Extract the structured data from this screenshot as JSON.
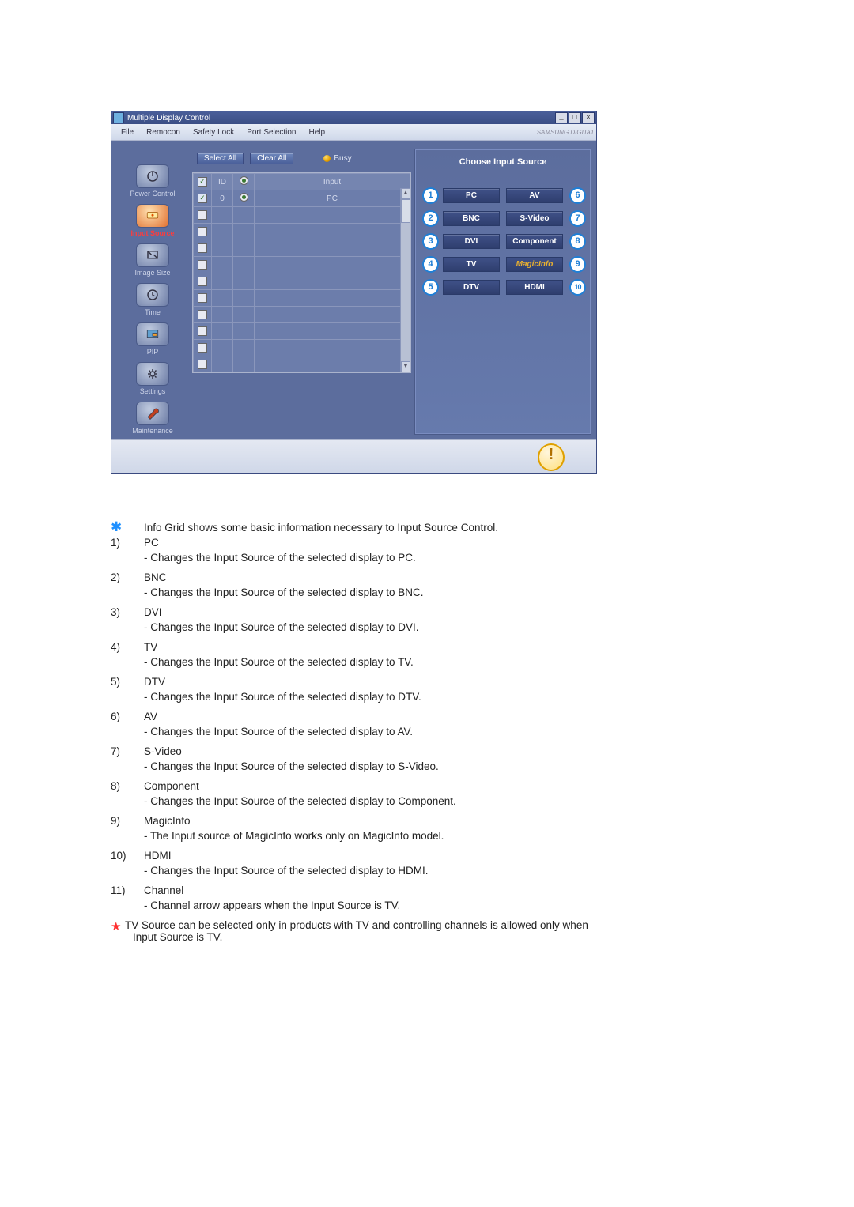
{
  "window": {
    "title": "Multiple Display Control",
    "menu": [
      "File",
      "Remocon",
      "Safety Lock",
      "Port Selection",
      "Help"
    ],
    "brand": "SAMSUNG DIGITall"
  },
  "sidebar": {
    "items": [
      {
        "label": "Power Control"
      },
      {
        "label": "Input Source"
      },
      {
        "label": "Image Size"
      },
      {
        "label": "Time"
      },
      {
        "label": "PIP"
      },
      {
        "label": "Settings"
      },
      {
        "label": "Maintenance"
      }
    ]
  },
  "toolbar": {
    "select_all": "Select All",
    "clear_all": "Clear All",
    "busy_label": "Busy"
  },
  "grid": {
    "headers": {
      "check": "✓",
      "id": "ID",
      "status": "",
      "input": "Input"
    },
    "row0": {
      "id": "0",
      "input": "PC"
    }
  },
  "right_panel": {
    "title": "Choose Input Source",
    "sources": {
      "s1": "PC",
      "s2": "BNC",
      "s3": "DVI",
      "s4": "TV",
      "s5": "DTV",
      "s6": "AV",
      "s7": "S-Video",
      "s8": "Component",
      "s9": "MagicInfo",
      "s10": "HDMI"
    },
    "numbers": {
      "n1": "1",
      "n2": "2",
      "n3": "3",
      "n4": "4",
      "n5": "5",
      "n6": "6",
      "n7": "7",
      "n8": "8",
      "n9": "9",
      "n10": "10"
    }
  },
  "explain": {
    "intro": "Info Grid shows some basic information necessary to Input Source Control.",
    "items": [
      {
        "n": "1)",
        "t": "PC",
        "d": "- Changes the Input Source of the selected display to PC."
      },
      {
        "n": "2)",
        "t": "BNC",
        "d": "- Changes the Input Source of the selected display to BNC."
      },
      {
        "n": "3)",
        "t": "DVI",
        "d": "- Changes the Input Source of the selected display to DVI."
      },
      {
        "n": "4)",
        "t": "TV",
        "d": "- Changes the Input Source of the selected display to TV."
      },
      {
        "n": "5)",
        "t": "DTV",
        "d": "- Changes the Input Source of the selected display to DTV."
      },
      {
        "n": "6)",
        "t": "AV",
        "d": "- Changes the Input Source of the selected display to AV."
      },
      {
        "n": "7)",
        "t": "S-Video",
        "d": "- Changes the Input Source of the selected display to S-Video."
      },
      {
        "n": "8)",
        "t": "Component",
        "d": "- Changes the Input Source of the selected display to Component."
      },
      {
        "n": "9)",
        "t": "MagicInfo",
        "d": "- The Input source of MagicInfo works only on MagicInfo model."
      },
      {
        "n": "10)",
        "t": "HDMI",
        "d": "- Changes the Input Source of the selected display to HDMI."
      },
      {
        "n": "11)",
        "t": "Channel",
        "d": "- Channel arrow appears when the Input Source is TV."
      }
    ],
    "footnote_a": "TV Source can be selected only in products with TV and controlling channels is allowed only when",
    "footnote_b": "Input Source is TV."
  }
}
